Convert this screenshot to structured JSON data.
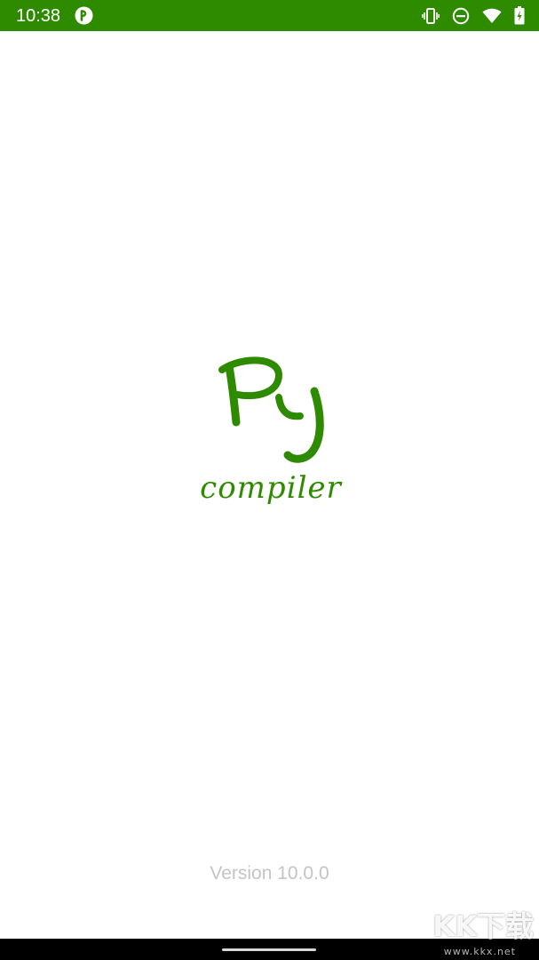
{
  "status_bar": {
    "time": "10:38",
    "icons": [
      "notification-p-icon",
      "vibrate-icon",
      "do-not-disturb-icon",
      "wifi-icon",
      "battery-charging-icon"
    ],
    "background_color": "#2e8b00"
  },
  "splash": {
    "logo_text": "Py",
    "logo_subtitle": "compiler",
    "logo_color": "#2e8b00",
    "version": "Version 10.0.0"
  },
  "watermark": {
    "main": "KK下载",
    "url": "www.kkx.net"
  }
}
